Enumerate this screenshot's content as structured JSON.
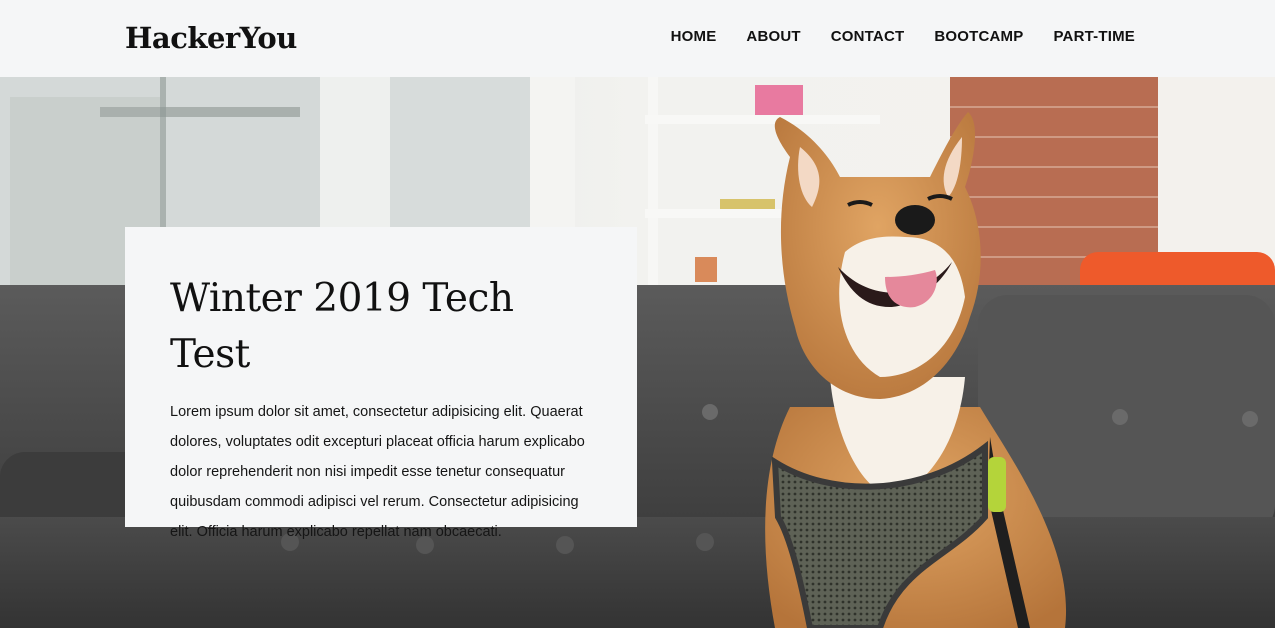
{
  "header": {
    "logo": "HackerYou",
    "nav": [
      {
        "label": "HOME"
      },
      {
        "label": "ABOUT"
      },
      {
        "label": "CONTACT"
      },
      {
        "label": "BOOTCAMP"
      },
      {
        "label": "PART-TIME"
      }
    ]
  },
  "hero": {
    "image": "shiba-inu-dog-on-grey-couch",
    "card": {
      "title": "Winter 2019 Tech Test",
      "body": "Lorem ipsum dolor sit amet, consectetur adipisicing elit. Quaerat dolores, voluptates odit excepturi placeat officia harum explicabo dolor reprehenderit non nisi impedit esse tenetur consequatur quibusdam commodi adipisci vel rerum. Consectetur adipisicing elit. Officia harum explicabo repellat nam obcaecati."
    }
  },
  "colors": {
    "header_bg": "#f5f6f7",
    "card_bg": "#f5f6f7",
    "text": "#111111",
    "couch": "#4a4a4a",
    "dog_fur": "#c98a48",
    "orange_chair": "#f05a28",
    "brick": "#b0694e"
  }
}
